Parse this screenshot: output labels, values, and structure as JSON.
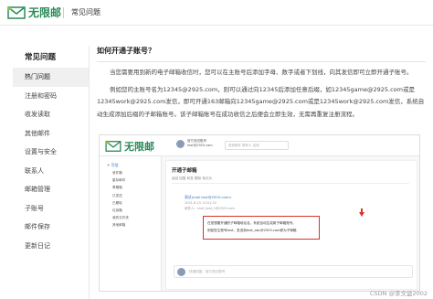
{
  "header": {
    "logo_text": "无限邮",
    "page_label": "常见问题",
    "brand_color": "#2a8a58"
  },
  "sidebar": {
    "heading": "常见问题",
    "items": [
      {
        "label": "热门问题",
        "active": true
      },
      {
        "label": "注册和密码",
        "active": false
      },
      {
        "label": "收发读取",
        "active": false
      },
      {
        "label": "其他邮件",
        "active": false
      },
      {
        "label": "设置与安全",
        "active": false
      },
      {
        "label": "联系人",
        "active": false
      },
      {
        "label": "邮箱管理",
        "active": false
      },
      {
        "label": "子账号",
        "active": false
      },
      {
        "label": "邮件保存",
        "active": false
      },
      {
        "label": "更新日记",
        "active": false
      }
    ]
  },
  "article": {
    "title": "如何开通子账号？",
    "paragraph_1": "当您需要用到新的电子邮箱收信时，您可以在主账号后添加字母、数字或者下划线，向其发信即可立即开通子账号。",
    "paragraph_2": "例如您的主账号名为12345@2925.com，则可以通过向12345后添加任意后缀，如12345game@2925.com或是12345work@2925.com发信，即可开通163邮箱向12345game@2925.com或是12345work@2925.com发信，系统自动生成添加后缀的子邮箱账号。该子邮箱账号在成功收信之后便会立即生效，无需再重复注册流程。"
  },
  "screenshot": {
    "logo_text": "无限邮",
    "user_line_1": "官方测试账号",
    "user_line_2": "test@2925.com",
    "search_placeholder": "查找邮件 联系人 应用",
    "compose_label": "+ 写信",
    "folders": [
      "收件箱",
      "星标邮件",
      "草稿箱",
      "已发送",
      "已删除",
      "垃圾箱",
      "我的文件夹",
      "其他邮箱"
    ],
    "main_title": "开通子邮箱",
    "tabs_text": "返回  回复  转发  删除  标记为",
    "sender": "测试(mail.test@2925.com>",
    "meta_line_1": "2021-6-15  15:01:32",
    "meta_line_2": "收件人：mail_test_1@2925.com",
    "box_line_1": "在您想要开通的子邮箱地址名，系统自动生成新子邮箱账号。",
    "box_line_2": "例如您主账号test，发送到test_abc@2925.com即为子邮箱",
    "reply_placeholder": "快速回复：官方测试账号",
    "highlight_color": "#d9322e"
  },
  "watermark": "CSDN @李文益2002"
}
